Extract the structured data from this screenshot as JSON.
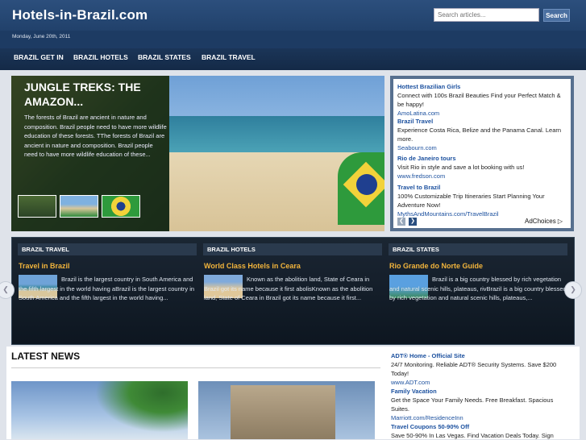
{
  "header": {
    "logo": "Hotels-in-Brazil.com",
    "search_placeholder": "Search articles...",
    "search_button": "Search",
    "date": "Monday, June 20th, 2011"
  },
  "nav": {
    "items": [
      "BRAZIL GET IN",
      "BRAZIL HOTELS",
      "BRAZIL STATES",
      "BRAZIL TRAVEL"
    ]
  },
  "featured": {
    "title": "JUNGLE TREKS: THE AMAZON...",
    "text": "The forests of Brazil are ancient in nature and composition. Brazil people need to have more wildlife education of these forests. TThe forests of Brazil are ancient in nature and composition. Brazil people need to have more wildlife education of these..."
  },
  "ads": [
    {
      "title": "Hottest Brazilian Girls",
      "text": "Connect with 100s Brazil Beauties Find your Perfect Match & be happy!",
      "url": "AmoLatina.com"
    },
    {
      "title": "Brazil Travel",
      "text": "Experience Costa Rica, Belize and the Panama Canal. Learn more.",
      "url": "Seabourn.com"
    },
    {
      "title": "Rio de Janeiro tours",
      "text": "Visit Rio in style and save a lot booking with us!",
      "url": "www.fredson.com"
    },
    {
      "title": "Travel to Brazil",
      "text": "100% Customizable Trip Itineraries Start Planning Your Adventure Now!",
      "url": "MythsAndMountains.com/TravelBrazil"
    }
  ],
  "ad_arrows": {
    "prev": "❮",
    "next": "❯"
  },
  "adchoices": "AdChoices ▷",
  "categories": [
    {
      "header": "BRAZIL TRAVEL",
      "title": "Travel in Brazil",
      "text": "Brazil is the largest country in South America and the fifth largest in the world having aBrazil is the largest country in South America and the fifth largest in the world having..."
    },
    {
      "header": "BRAZIL HOTELS",
      "title": "World Class Hotels in Ceara",
      "text": "Known as the abolition land, State of Ceara in Brazil got its name because it first abolisKnown as the abolition land, State of Ceara in Brazil got its name because it first..."
    },
    {
      "header": "BRAZIL STATES",
      "title": "Rio Grande do Norte Guide",
      "text": "Brazil is a big country blessed by rich vegetation and natural scenic hills, plateaus, rivBrazil is a big country blessed by rich vegetation and natural scenic hills, plateaus,..."
    }
  ],
  "slider_arrows": {
    "left": "❮",
    "right": "❯"
  },
  "latest_news": "LATEST NEWS",
  "side_ads": [
    {
      "title": "ADT® Home - Official Site",
      "text": "24/7 Monitoring. Reliable ADT® Security Systems. Save $200 Today!",
      "url": "www.ADT.com"
    },
    {
      "title": "Family Vacation",
      "text": "Get the Space Your Family Needs. Free Breakfast. Spacious Suites.",
      "url": "Marriott.com/ResidenceInn"
    },
    {
      "title": "Travel Coupons 50-90% Off",
      "text": "Save 50-90% In Las Vegas. Find Vacation Deals Today. Sign",
      "url": ""
    }
  ]
}
